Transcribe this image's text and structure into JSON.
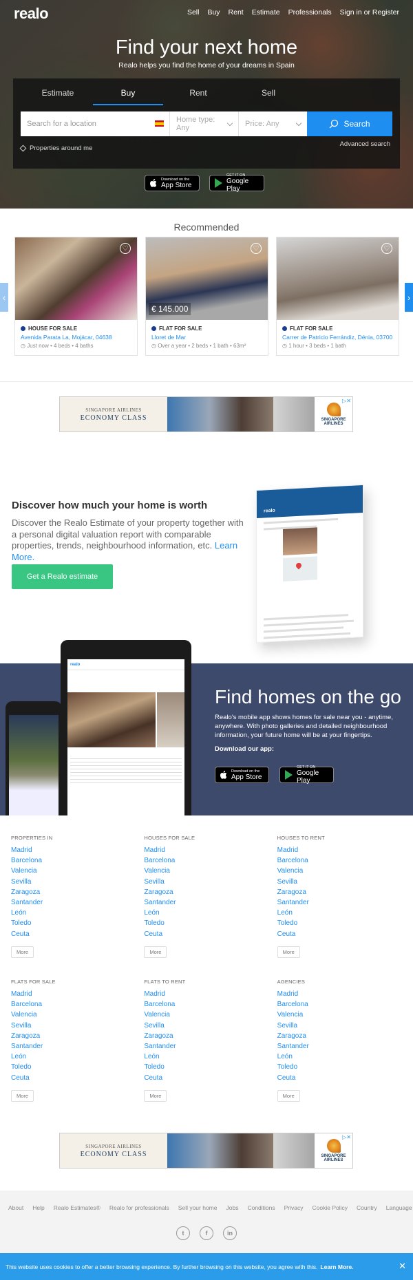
{
  "brand": {
    "logo": "realo"
  },
  "topnav": [
    "Sell",
    "Buy",
    "Rent",
    "Estimate",
    "Professionals",
    "Sign in or Register"
  ],
  "hero": {
    "title": "Find your next home",
    "subtitle": "Realo helps you find the home of your dreams in Spain"
  },
  "search": {
    "tabs": [
      "Estimate",
      "Buy",
      "Rent",
      "Sell"
    ],
    "active_tab": "Buy",
    "location_placeholder": "Search for a location",
    "home_type": "Home type: Any",
    "price": "Price: Any",
    "button": "Search",
    "advanced": "Advanced search",
    "around_me": "Properties around me"
  },
  "stores": {
    "apple_small": "Download on the",
    "apple_big": "App Store",
    "google_small": "GET IT ON",
    "google_big": "Google Play"
  },
  "recommended": {
    "title": "Recommended",
    "cards": [
      {
        "type": "HOUSE FOR SALE",
        "address": "Avenida Parata La, Mojácar, 04638",
        "meta": "Just now • 4 beds • 4 baths",
        "price": ""
      },
      {
        "type": "FLAT FOR SALE",
        "address": "Lloret de Mar",
        "meta": "Over a year • 2 beds • 1 bath • 63m²",
        "price": "€ 145.000"
      },
      {
        "type": "FLAT FOR SALE",
        "address": "Carrer de Patricio Ferrándiz, Dénia, 03700",
        "meta": "1 hour • 3 beds • 1 bath",
        "price": ""
      }
    ]
  },
  "ad": {
    "line1": "SINGAPORE AIRLINES",
    "line2": "ECONOMY CLASS",
    "brand1": "SINGAPORE",
    "brand2": "AIRLINES"
  },
  "estimate": {
    "title": "Discover how much your home is worth",
    "text": "Discover the Realo Estimate of your property together with a personal digital valuation report with comparable properties, trends, neighbourhood information, etc.",
    "learn_more": "Learn More.",
    "button": "Get a Realo estimate"
  },
  "app": {
    "title": "Find homes on the go",
    "text": "Realo's mobile app shows homes for sale near you - anytime, anywhere. With photo galleries and detailed neighbourhood information, your future home will be at your fingertips.",
    "download": "Download our app:"
  },
  "cities": [
    "Madrid",
    "Barcelona",
    "Valencia",
    "Sevilla",
    "Zaragoza",
    "Santander",
    "León",
    "Toledo",
    "Ceuta"
  ],
  "link_columns": [
    {
      "title": "PROPERTIES IN"
    },
    {
      "title": "HOUSES FOR SALE"
    },
    {
      "title": "HOUSES TO RENT"
    },
    {
      "title": "FLATS FOR SALE"
    },
    {
      "title": "FLATS TO RENT"
    },
    {
      "title": "AGENCIES"
    }
  ],
  "more_label": "More",
  "footer": {
    "links": [
      "About",
      "Help",
      "Realo Estimates®",
      "Realo for professionals",
      "Sell your home",
      "Jobs",
      "Conditions",
      "Privacy",
      "Cookie Policy",
      "Country",
      "Language"
    ],
    "social": [
      "twitter-icon",
      "facebook-icon",
      "linkedin-icon"
    ]
  },
  "cookie": {
    "text": "This website uses cookies to offer a better browsing experience. By further browsing on this website, you agree with this.",
    "learn_more": "Learn More."
  },
  "colors": {
    "primary": "#1f8ef1",
    "green": "#38c682",
    "navy": "#3d4a6b"
  }
}
